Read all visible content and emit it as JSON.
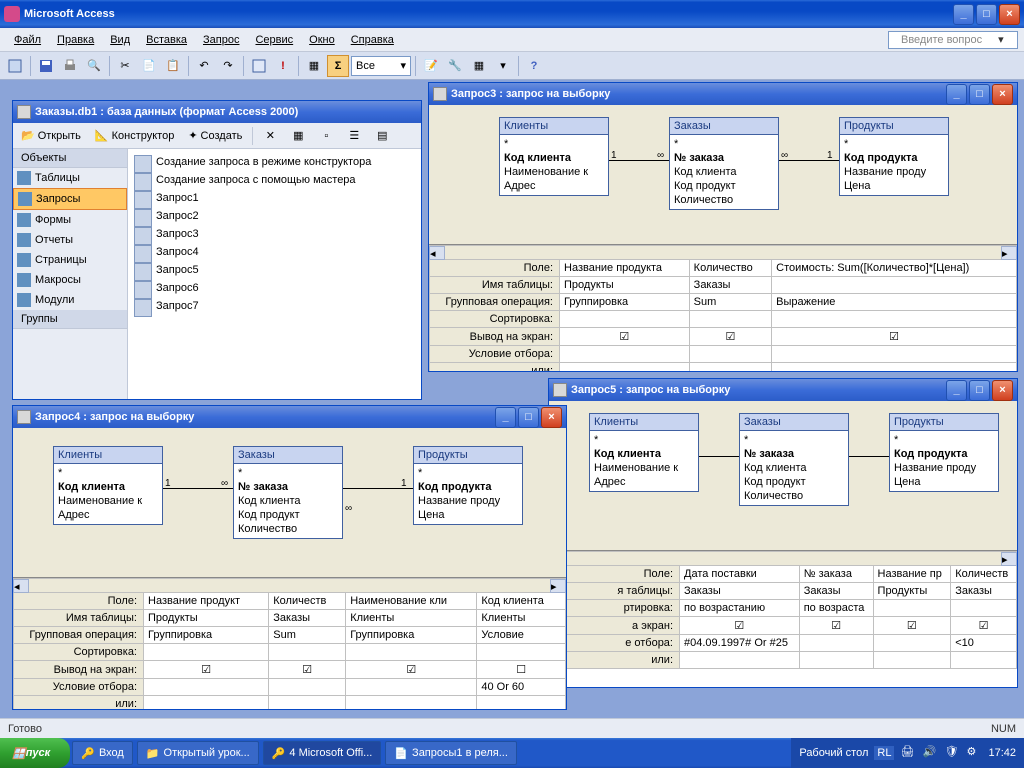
{
  "app": {
    "title": "Microsoft Access"
  },
  "menu": {
    "file": "Файл",
    "edit": "Правка",
    "view": "Вид",
    "insert": "Вставка",
    "query": "Запрос",
    "tools": "Сервис",
    "window": "Окно",
    "help": "Справка",
    "helpbox": "Введите вопрос"
  },
  "toolbar": {
    "sigma": "Σ",
    "combo": "Все"
  },
  "dbwin": {
    "title": "Заказы.db1 : база данных (формат Access 2000)",
    "tb": {
      "open": "Открыть",
      "design": "Конструктор",
      "create": "Создать"
    },
    "objhdr": "Объекты",
    "grphdr": "Группы",
    "objs": {
      "tables": "Таблицы",
      "queries": "Запросы",
      "forms": "Формы",
      "reports": "Отчеты",
      "pages": "Страницы",
      "macros": "Макросы",
      "modules": "Модули"
    },
    "items": {
      "new_design": "Создание запроса в режиме конструктора",
      "new_wizard": "Создание запроса с помощью мастера",
      "q1": "Запрос1",
      "q2": "Запрос2",
      "q3": "Запрос3",
      "q4": "Запрос4",
      "q5": "Запрос5",
      "q6": "Запрос6",
      "q7": "Запрос7"
    }
  },
  "tables": {
    "clients": {
      "title": "Клиенты",
      "star": "*",
      "pk": "Код клиента",
      "f1": "Наименование к",
      "f2": "Адрес"
    },
    "orders": {
      "title": "Заказы",
      "star": "*",
      "pk": "№ заказа",
      "f1": "Код клиента",
      "f2": "Код продукт",
      "f3": "Количество"
    },
    "products": {
      "title": "Продукты",
      "star": "*",
      "pk": "Код продукта",
      "f1": "Название проду",
      "f2": "Цена"
    }
  },
  "gridlabels": {
    "field": "Поле:",
    "table": "Имя таблицы:",
    "groupop": "Групповая операция:",
    "sort": "Сортировка:",
    "show": "Вывод на экран:",
    "crit": "Условие отбора:",
    "or": "или:",
    "sort2": "ртировка:",
    "show2": "а экран:",
    "crit2": "е отбора:",
    "table2": "я таблицы:"
  },
  "q3": {
    "title": "Запрос3 : запрос на выборку",
    "r": {
      "c1": "Название продукта",
      "c2": "Количество",
      "c3": "Стоимость: Sum([Количество]*[Цена])",
      "t1": "Продукты",
      "t2": "Заказы",
      "t3": "",
      "g1": "Группировка",
      "g2": "Sum",
      "g3": "Выражение"
    }
  },
  "q4": {
    "title": "Запрос4 : запрос на выборку",
    "r": {
      "c1": "Название продукт",
      "c2": "Количеств",
      "c3": "Наименование кли",
      "c4": "Код клиента",
      "t1": "Продукты",
      "t2": "Заказы",
      "t3": "Клиенты",
      "t4": "Клиенты",
      "g1": "Группировка",
      "g2": "Sum",
      "g3": "Группировка",
      "g4": "Условие",
      "crit4": "40 Or 60"
    }
  },
  "q5": {
    "title": "Запрос5 : запрос на выборку",
    "r": {
      "c1": "Дата поставки",
      "c2": "№ заказа",
      "c3": "Название пр",
      "c4": "Количеств",
      "t1": "Заказы",
      "t2": "Заказы",
      "t3": "Продукты",
      "t4": "Заказы",
      "s1": "по возрастанию",
      "s2": "по возраста",
      "crit1": "#04.09.1997# Or #25",
      "crit4": "<10"
    }
  },
  "status": {
    "ready": "Готово",
    "num": "NUM"
  },
  "taskbar": {
    "start": "пуск",
    "items": {
      "i1": "Вход",
      "i2": "Открытый урок...",
      "i3": "4 Microsoft Offi...",
      "i4": "Запросы1 в реля..."
    },
    "desktop": "Рабочий стол",
    "lang": "RL",
    "time": "17:42"
  },
  "rel": {
    "one": "1",
    "many": "∞"
  }
}
